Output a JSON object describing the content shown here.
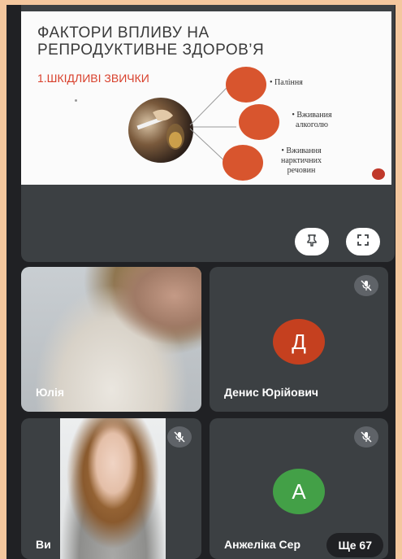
{
  "presentation": {
    "slide_title": "ФАКТОРИ ВПЛИВУ НА РЕПРОДУКТИВНЕ ЗДОРОВ’Я",
    "slide_subtitle": "1.ШКІДЛИВІ ЗВИЧКИ",
    "bullets": [
      "Паління",
      "Вживания алкоголю",
      "Вживання нарктичних речовин"
    ]
  },
  "controls": {
    "pin_icon": "pin-icon",
    "fullscreen_icon": "fullscreen-icon"
  },
  "participants": [
    {
      "name": "Юлія",
      "muted": false,
      "video": true
    },
    {
      "name": "Денис Юрійович",
      "initial": "Д",
      "avatar_color": "#c5401f",
      "muted": true
    },
    {
      "name": "Ви",
      "muted": true,
      "video": true
    },
    {
      "name": "Анжеліка Сер",
      "initial": "А",
      "avatar_color": "#43a047",
      "muted": true
    }
  ],
  "more": {
    "label": "Ще 67"
  },
  "colors": {
    "background": "#202124",
    "tile": "#3c4043",
    "accent": "#d8552e"
  }
}
